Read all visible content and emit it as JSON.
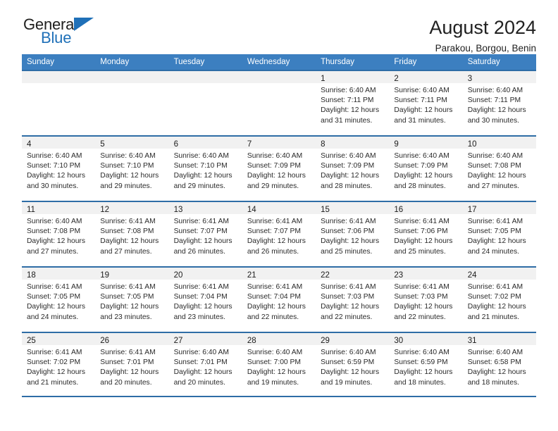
{
  "brand": {
    "name_top": "General",
    "name_bottom": "Blue",
    "accent_color": "#1f70b8"
  },
  "header": {
    "month_title": "August 2024",
    "location": "Parakou, Borgou, Benin"
  },
  "theme": {
    "header_row_bg": "#3c7fc0",
    "row_rule": "#2e6da6",
    "day_band_bg": "#f1f1f1"
  },
  "weekdays": [
    "Sunday",
    "Monday",
    "Tuesday",
    "Wednesday",
    "Thursday",
    "Friday",
    "Saturday"
  ],
  "weeks": [
    [
      {
        "day": "",
        "empty": true,
        "sunrise": "",
        "sunset": "",
        "daylight_1": "",
        "daylight_2": ""
      },
      {
        "day": "",
        "empty": true,
        "sunrise": "",
        "sunset": "",
        "daylight_1": "",
        "daylight_2": ""
      },
      {
        "day": "",
        "empty": true,
        "sunrise": "",
        "sunset": "",
        "daylight_1": "",
        "daylight_2": ""
      },
      {
        "day": "",
        "empty": true,
        "sunrise": "",
        "sunset": "",
        "daylight_1": "",
        "daylight_2": ""
      },
      {
        "day": "1",
        "sunrise": "Sunrise: 6:40 AM",
        "sunset": "Sunset: 7:11 PM",
        "daylight_1": "Daylight: 12 hours",
        "daylight_2": "and 31 minutes."
      },
      {
        "day": "2",
        "sunrise": "Sunrise: 6:40 AM",
        "sunset": "Sunset: 7:11 PM",
        "daylight_1": "Daylight: 12 hours",
        "daylight_2": "and 31 minutes."
      },
      {
        "day": "3",
        "sunrise": "Sunrise: 6:40 AM",
        "sunset": "Sunset: 7:11 PM",
        "daylight_1": "Daylight: 12 hours",
        "daylight_2": "and 30 minutes."
      }
    ],
    [
      {
        "day": "4",
        "sunrise": "Sunrise: 6:40 AM",
        "sunset": "Sunset: 7:10 PM",
        "daylight_1": "Daylight: 12 hours",
        "daylight_2": "and 30 minutes."
      },
      {
        "day": "5",
        "sunrise": "Sunrise: 6:40 AM",
        "sunset": "Sunset: 7:10 PM",
        "daylight_1": "Daylight: 12 hours",
        "daylight_2": "and 29 minutes."
      },
      {
        "day": "6",
        "sunrise": "Sunrise: 6:40 AM",
        "sunset": "Sunset: 7:10 PM",
        "daylight_1": "Daylight: 12 hours",
        "daylight_2": "and 29 minutes."
      },
      {
        "day": "7",
        "sunrise": "Sunrise: 6:40 AM",
        "sunset": "Sunset: 7:09 PM",
        "daylight_1": "Daylight: 12 hours",
        "daylight_2": "and 29 minutes."
      },
      {
        "day": "8",
        "sunrise": "Sunrise: 6:40 AM",
        "sunset": "Sunset: 7:09 PM",
        "daylight_1": "Daylight: 12 hours",
        "daylight_2": "and 28 minutes."
      },
      {
        "day": "9",
        "sunrise": "Sunrise: 6:40 AM",
        "sunset": "Sunset: 7:09 PM",
        "daylight_1": "Daylight: 12 hours",
        "daylight_2": "and 28 minutes."
      },
      {
        "day": "10",
        "sunrise": "Sunrise: 6:40 AM",
        "sunset": "Sunset: 7:08 PM",
        "daylight_1": "Daylight: 12 hours",
        "daylight_2": "and 27 minutes."
      }
    ],
    [
      {
        "day": "11",
        "sunrise": "Sunrise: 6:40 AM",
        "sunset": "Sunset: 7:08 PM",
        "daylight_1": "Daylight: 12 hours",
        "daylight_2": "and 27 minutes."
      },
      {
        "day": "12",
        "sunrise": "Sunrise: 6:41 AM",
        "sunset": "Sunset: 7:08 PM",
        "daylight_1": "Daylight: 12 hours",
        "daylight_2": "and 27 minutes."
      },
      {
        "day": "13",
        "sunrise": "Sunrise: 6:41 AM",
        "sunset": "Sunset: 7:07 PM",
        "daylight_1": "Daylight: 12 hours",
        "daylight_2": "and 26 minutes."
      },
      {
        "day": "14",
        "sunrise": "Sunrise: 6:41 AM",
        "sunset": "Sunset: 7:07 PM",
        "daylight_1": "Daylight: 12 hours",
        "daylight_2": "and 26 minutes."
      },
      {
        "day": "15",
        "sunrise": "Sunrise: 6:41 AM",
        "sunset": "Sunset: 7:06 PM",
        "daylight_1": "Daylight: 12 hours",
        "daylight_2": "and 25 minutes."
      },
      {
        "day": "16",
        "sunrise": "Sunrise: 6:41 AM",
        "sunset": "Sunset: 7:06 PM",
        "daylight_1": "Daylight: 12 hours",
        "daylight_2": "and 25 minutes."
      },
      {
        "day": "17",
        "sunrise": "Sunrise: 6:41 AM",
        "sunset": "Sunset: 7:05 PM",
        "daylight_1": "Daylight: 12 hours",
        "daylight_2": "and 24 minutes."
      }
    ],
    [
      {
        "day": "18",
        "sunrise": "Sunrise: 6:41 AM",
        "sunset": "Sunset: 7:05 PM",
        "daylight_1": "Daylight: 12 hours",
        "daylight_2": "and 24 minutes."
      },
      {
        "day": "19",
        "sunrise": "Sunrise: 6:41 AM",
        "sunset": "Sunset: 7:05 PM",
        "daylight_1": "Daylight: 12 hours",
        "daylight_2": "and 23 minutes."
      },
      {
        "day": "20",
        "sunrise": "Sunrise: 6:41 AM",
        "sunset": "Sunset: 7:04 PM",
        "daylight_1": "Daylight: 12 hours",
        "daylight_2": "and 23 minutes."
      },
      {
        "day": "21",
        "sunrise": "Sunrise: 6:41 AM",
        "sunset": "Sunset: 7:04 PM",
        "daylight_1": "Daylight: 12 hours",
        "daylight_2": "and 22 minutes."
      },
      {
        "day": "22",
        "sunrise": "Sunrise: 6:41 AM",
        "sunset": "Sunset: 7:03 PM",
        "daylight_1": "Daylight: 12 hours",
        "daylight_2": "and 22 minutes."
      },
      {
        "day": "23",
        "sunrise": "Sunrise: 6:41 AM",
        "sunset": "Sunset: 7:03 PM",
        "daylight_1": "Daylight: 12 hours",
        "daylight_2": "and 22 minutes."
      },
      {
        "day": "24",
        "sunrise": "Sunrise: 6:41 AM",
        "sunset": "Sunset: 7:02 PM",
        "daylight_1": "Daylight: 12 hours",
        "daylight_2": "and 21 minutes."
      }
    ],
    [
      {
        "day": "25",
        "sunrise": "Sunrise: 6:41 AM",
        "sunset": "Sunset: 7:02 PM",
        "daylight_1": "Daylight: 12 hours",
        "daylight_2": "and 21 minutes."
      },
      {
        "day": "26",
        "sunrise": "Sunrise: 6:41 AM",
        "sunset": "Sunset: 7:01 PM",
        "daylight_1": "Daylight: 12 hours",
        "daylight_2": "and 20 minutes."
      },
      {
        "day": "27",
        "sunrise": "Sunrise: 6:40 AM",
        "sunset": "Sunset: 7:01 PM",
        "daylight_1": "Daylight: 12 hours",
        "daylight_2": "and 20 minutes."
      },
      {
        "day": "28",
        "sunrise": "Sunrise: 6:40 AM",
        "sunset": "Sunset: 7:00 PM",
        "daylight_1": "Daylight: 12 hours",
        "daylight_2": "and 19 minutes."
      },
      {
        "day": "29",
        "sunrise": "Sunrise: 6:40 AM",
        "sunset": "Sunset: 6:59 PM",
        "daylight_1": "Daylight: 12 hours",
        "daylight_2": "and 19 minutes."
      },
      {
        "day": "30",
        "sunrise": "Sunrise: 6:40 AM",
        "sunset": "Sunset: 6:59 PM",
        "daylight_1": "Daylight: 12 hours",
        "daylight_2": "and 18 minutes."
      },
      {
        "day": "31",
        "sunrise": "Sunrise: 6:40 AM",
        "sunset": "Sunset: 6:58 PM",
        "daylight_1": "Daylight: 12 hours",
        "daylight_2": "and 18 minutes."
      }
    ]
  ]
}
